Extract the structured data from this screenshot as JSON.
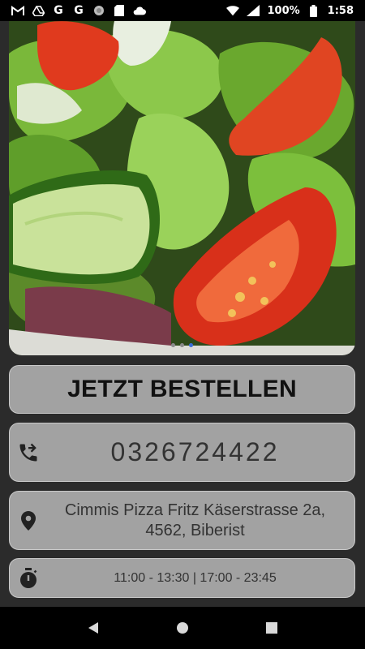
{
  "status_bar": {
    "app_icons": [
      "gmail-icon",
      "drive-icon",
      "google-icon",
      "google-icon",
      "circle-icon",
      "sd-card-icon",
      "cloud-icon"
    ],
    "battery": "100%",
    "time": "1:58"
  },
  "carousel": {
    "image": "salad-image",
    "pages": 3,
    "active_page": 2
  },
  "order": {
    "label": "JETZT BESTELLEN"
  },
  "contact": {
    "phone": "0326724422",
    "address": "Cimmis Pizza  Fritz Käserstrasse 2a, 4562, Biberist",
    "hours": "11:00 - 13:30 | 17:00 - 23:45"
  },
  "colors": {
    "card_bg": "#a2a2a2",
    "background": "#2b2b2b",
    "accent_dot": "#3a6fd9"
  }
}
